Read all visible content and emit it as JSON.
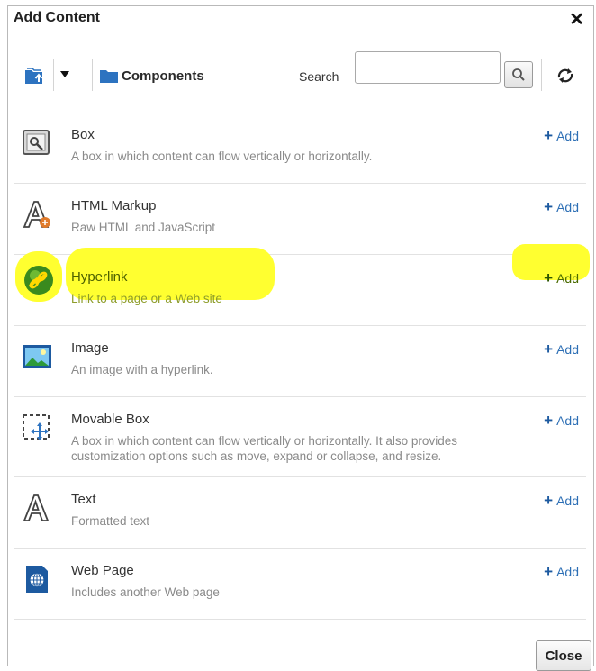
{
  "dialog": {
    "title": "Add Content",
    "close_glyph": "✕",
    "close_button_label": "Close"
  },
  "toolbar": {
    "folder_icon": "folder-up-icon",
    "components_label": "Components",
    "search_label": "Search",
    "search_value": "",
    "search_placeholder": "",
    "refresh_icon": "refresh-icon"
  },
  "items": [
    {
      "name": "Box",
      "description": "A box in which content can flow vertically or horizontally.",
      "add_label": "Add",
      "icon": "box-icon"
    },
    {
      "name": "HTML Markup",
      "description": "Raw HTML and JavaScript",
      "add_label": "Add",
      "icon": "html-markup-icon"
    },
    {
      "name": "Hyperlink",
      "description": "Link to a page or a Web site",
      "add_label": "Add",
      "icon": "hyperlink-icon",
      "highlighted": true
    },
    {
      "name": "Image",
      "description": "An image with a hyperlink.",
      "add_label": "Add",
      "icon": "image-icon"
    },
    {
      "name": "Movable Box",
      "description": "A box in which content can flow vertically or horizontally. It also provides customization options such as move, expand or collapse, and resize.",
      "add_label": "Add",
      "icon": "movable-box-icon"
    },
    {
      "name": "Text",
      "description": "Formatted text",
      "add_label": "Add",
      "icon": "text-icon"
    },
    {
      "name": "Web Page",
      "description": "Includes another Web page",
      "add_label": "Add",
      "icon": "web-page-icon"
    }
  ],
  "colors": {
    "link_blue": "#2d6fb5",
    "highlight_yellow": "#ffff30"
  }
}
